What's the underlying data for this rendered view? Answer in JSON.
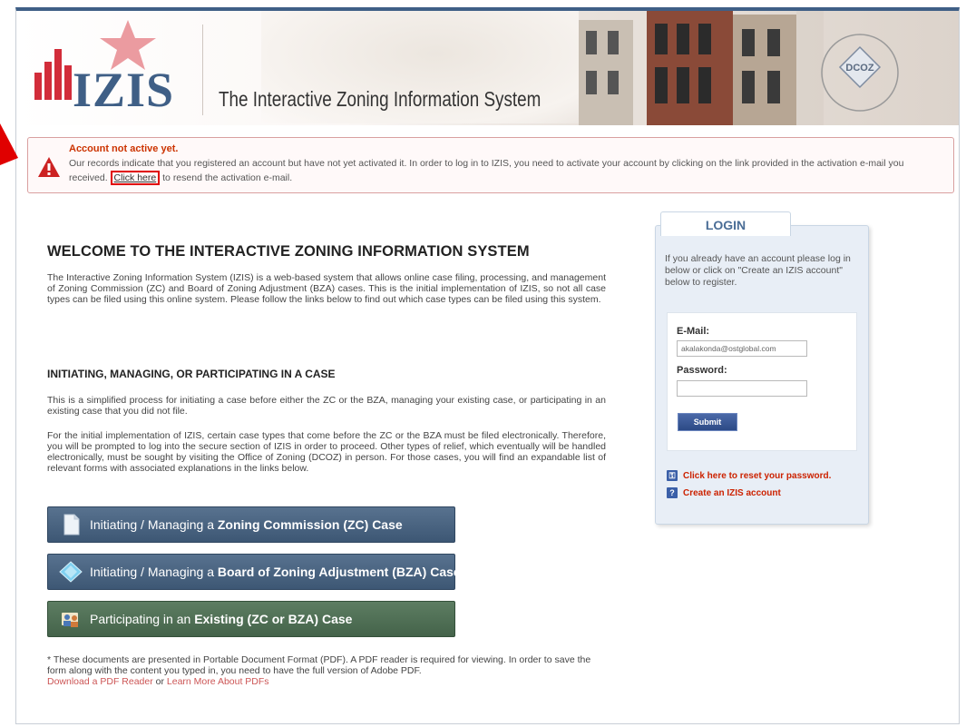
{
  "header": {
    "logo_text": "IZIS",
    "title": "The Interactive Zoning Information System",
    "seal_text": "DCOZ"
  },
  "alert": {
    "title": "Account not active yet.",
    "text_before": "Our records indicate that you registered an account but have not yet activated it. In order to log in to IZIS, you need to activate your account by clicking on the link provided in the activation e-mail you received.",
    "link_label": "Click here",
    "text_after": "to resend the activation e-mail."
  },
  "main": {
    "welcome_title": "WELCOME TO THE INTERACTIVE ZONING INFORMATION SYSTEM",
    "intro": "The Interactive Zoning Information System (IZIS) is a web-based system that allows online case filing, processing, and management of Zoning Commission (ZC) and Board of Zoning Adjustment (BZA) cases. This is the initial implementation of IZIS, so not all case types can be filed using this online system. Please follow the links below to find out which case types can be filed using this system.",
    "section_title": "INITIATING, MANAGING, OR PARTICIPATING IN A CASE",
    "section_p1": "This is a simplified process for initiating a case before either the ZC or the BZA, managing your existing case, or participating in an existing case that you did not file.",
    "section_p2": "For the initial implementation of IZIS, certain case types that come before the ZC or the BZA must be filed electronically. Therefore, you will be prompted to log into the secure section of IZIS in order to proceed. Other types of relief, which eventually will be handled electronically, must be sought by visiting the Office of Zoning (DCOZ) in person. For those cases, you will find an expandable list of relevant forms with associated explanations in the links below.",
    "buttons": [
      {
        "prefix": "Initiating / Managing a ",
        "bold": "Zoning Commission (ZC) Case",
        "icon": "document-icon"
      },
      {
        "prefix": "Initiating / Managing a ",
        "bold": "Board of Zoning Adjustment (BZA) Case",
        "icon": "diamond-icon"
      },
      {
        "prefix": "Participating in an ",
        "bold": "Existing (ZC or BZA) Case",
        "icon": "people-icon"
      }
    ],
    "footnote": "* These documents are presented in Portable Document Format (PDF). A PDF reader is required for viewing. In order to save the form along with the content you typed in, you need to have the full version of Adobe PDF.",
    "download_link": "Download a PDF Reader",
    "or_text": " or ",
    "learn_link": "Learn More About PDFs"
  },
  "login": {
    "tab_label": "LOGIN",
    "intro": "If you already have an account please log in below or click on \"Create an IZIS account\" below to register.",
    "email_label": "E-Mail:",
    "email_value": "akalakonda@ostglobal.com",
    "password_label": "Password:",
    "password_value": "",
    "submit_label": "Submit",
    "reset_link": "Click here to reset your password.",
    "create_link": "Create an IZIS account"
  },
  "colors": {
    "brand_blue": "#3f5f86",
    "alert_red": "#cc3300",
    "link_red": "#cc2200"
  }
}
